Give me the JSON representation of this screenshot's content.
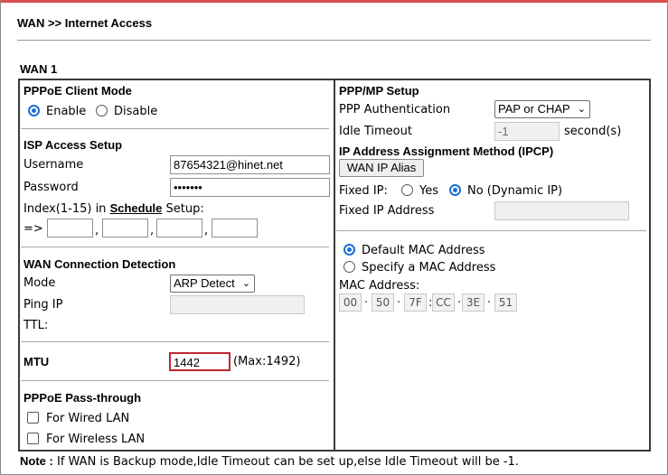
{
  "header": {
    "breadcrumb": "WAN >> Internet Access"
  },
  "section_title": "WAN 1",
  "pppoe": {
    "title": "PPPoE Client Mode",
    "enable_label": "Enable",
    "disable_label": "Disable",
    "selected": "Enable"
  },
  "isp": {
    "title": "ISP Access Setup",
    "username_label": "Username",
    "username_value": "87654321@hinet.net",
    "password_label": "Password",
    "password_value": "•••••••",
    "index_prefix": "Index(1-15) in",
    "schedule_link": "Schedule",
    "index_suffix": "Setup:",
    "arrow": "=>",
    "comma": ","
  },
  "detection": {
    "title": "WAN Connection Detection",
    "mode_label": "Mode",
    "mode_value": "ARP Detect",
    "ping_label": "Ping IP",
    "ttl_label": "TTL:"
  },
  "mtu": {
    "label": "MTU",
    "value": "1442",
    "max_text": "(Max:1492)"
  },
  "passthrough": {
    "title": "PPPoE Pass-through",
    "wired_label": "For Wired LAN",
    "wireless_label": "For Wireless LAN"
  },
  "ppp": {
    "title": "PPP/MP Setup",
    "auth_label": "PPP Authentication",
    "auth_value": "PAP or CHAP",
    "idle_label": "Idle Timeout",
    "idle_value": "-1",
    "idle_unit": "second(s)"
  },
  "ipcp": {
    "title": "IP Address Assignment Method (IPCP)",
    "alias_button": "WAN IP Alias",
    "fixed_ip_label": "Fixed IP:",
    "yes_label": "Yes",
    "no_label": "No (Dynamic IP)",
    "selected": "No (Dynamic IP)",
    "fixed_addr_label": "Fixed IP Address"
  },
  "mac": {
    "default_label": "Default MAC Address",
    "specify_label": "Specify a MAC Address",
    "selected": "Default MAC Address",
    "address_label": "MAC Address:",
    "octets": [
      "00",
      "50",
      "7F",
      "CC",
      "3E",
      "51"
    ]
  },
  "note": {
    "label": "Note :",
    "text": "If WAN is Backup mode,Idle Timeout can be set up,else Idle Timeout will be -1."
  }
}
